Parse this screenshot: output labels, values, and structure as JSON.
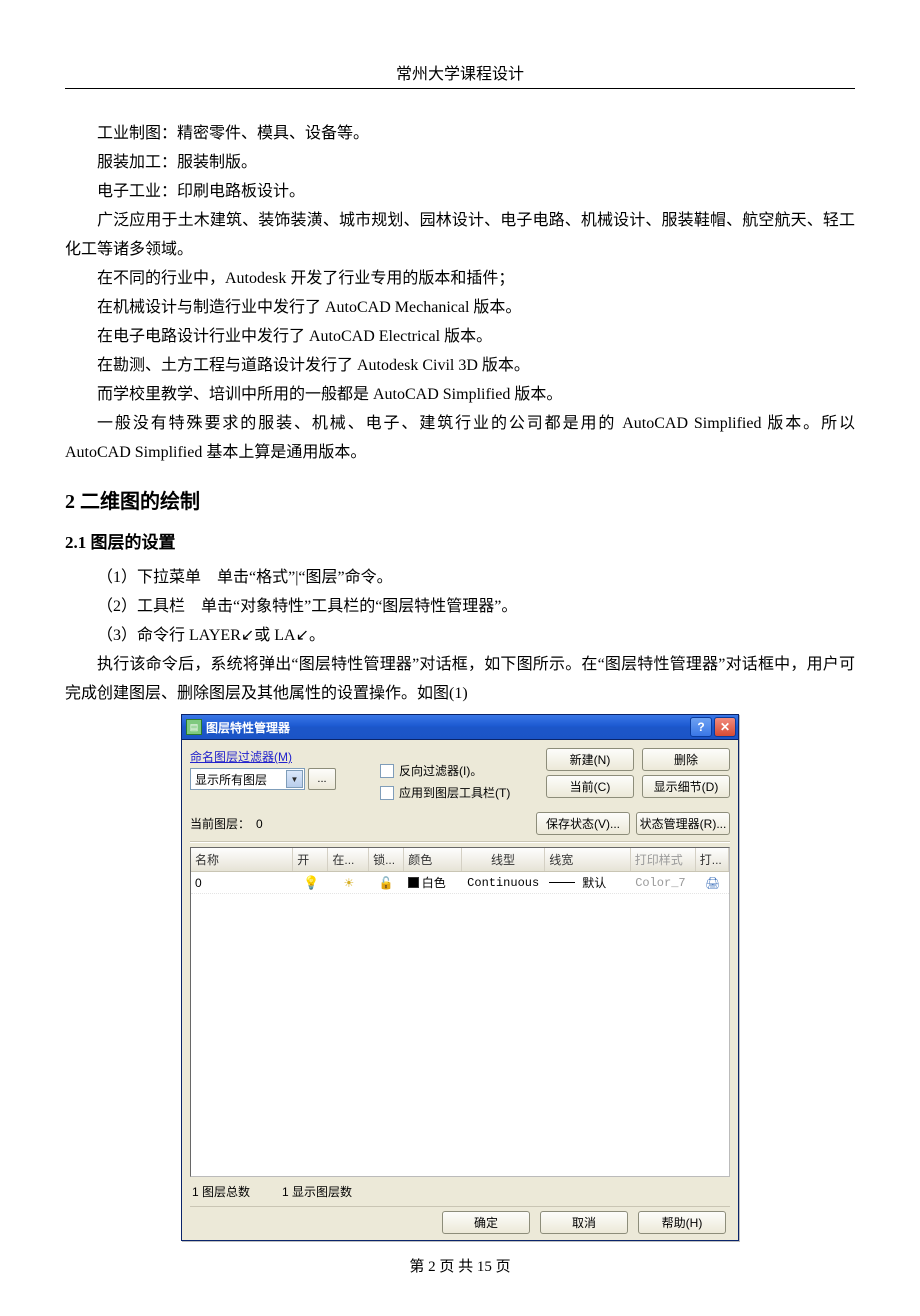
{
  "doc": {
    "running_head": "常州大学课程设计",
    "footer": "第 2 页 共 15 页",
    "paras": [
      "工业制图：精密零件、模具、设备等。",
      "服装加工：服装制版。",
      "电子工业：印刷电路板设计。",
      "广泛应用于土木建筑、装饰装潢、城市规划、园林设计、电子电路、机械设计、服装鞋帽、航空航天、轻工化工等诸多领域。",
      "在不同的行业中，Autodesk 开发了行业专用的版本和插件；",
      "在机械设计与制造行业中发行了 AutoCAD Mechanical 版本。",
      "在电子电路设计行业中发行了 AutoCAD Electrical 版本。",
      "在勘测、土方工程与道路设计发行了 Autodesk Civil 3D 版本。",
      "而学校里教学、培训中所用的一般都是 AutoCAD Simplified 版本。",
      "一般没有特殊要求的服装、机械、电子、建筑行业的公司都是用的 AutoCAD Simplified 版本。所以 AutoCAD Simplified 基本上算是通用版本。"
    ],
    "h2": "2 二维图的绘制",
    "h3": "2.1 图层的设置",
    "list": [
      "（1）下拉菜单　单击“格式”|“图层”命令。",
      "（2）工具栏　单击“对象特性”工具栏的“图层特性管理器”。",
      "（3）命令行 LAYER↙或 LA↙。"
    ],
    "after_list": " 执行该命令后，系统将弹出“图层特性管理器”对话框，如下图所示。在“图层特性管理器”对话框中，用户可完成创建图层、删除图层及其他属性的设置操作。如图(1)"
  },
  "dlg": {
    "title": "图层特性管理器",
    "filter_label": "命名图层过滤器(M)",
    "combo_value": "显示所有图层",
    "browse_btn": "...",
    "chk_invert": "反向过滤器(I)。",
    "chk_apply": "应用到图层工具栏(T)",
    "btn_new": "新建(N)",
    "btn_delete": "删除",
    "btn_current": "当前(C)",
    "btn_detail": "显示细节(D)",
    "btn_savestate": "保存状态(V)...",
    "btn_statemgr": "状态管理器(R)...",
    "current_layer_label": "当前图层：",
    "current_layer_value": "0",
    "headers": {
      "name": "名称",
      "on": "开",
      "freeze": "在...",
      "lock": "锁...",
      "color": "颜色",
      "ltype": "线型",
      "lweight": "线宽",
      "pstyle": "打印样式",
      "print": "打..."
    },
    "row": {
      "name": "0",
      "color_name": "白色",
      "ltype": "Continuous",
      "lweight": "默认",
      "pstyle": "Color_7"
    },
    "status_total_label": "1 图层总数",
    "status_shown_label": "1 显示图层数",
    "btn_ok": "确定",
    "btn_cancel": "取消",
    "btn_help": "帮助(H)"
  }
}
